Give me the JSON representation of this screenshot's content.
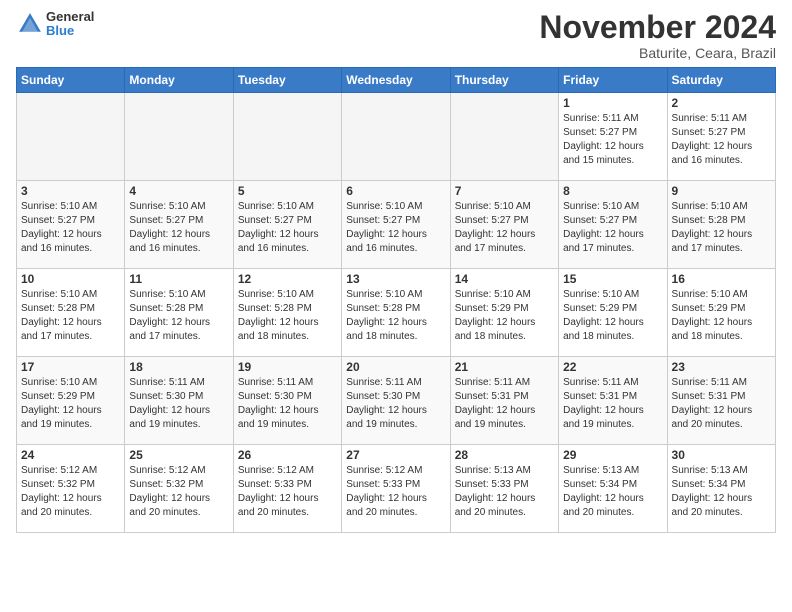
{
  "logo": {
    "general": "General",
    "blue": "Blue"
  },
  "header": {
    "month": "November 2024",
    "location": "Baturite, Ceara, Brazil"
  },
  "weekdays": [
    "Sunday",
    "Monday",
    "Tuesday",
    "Wednesday",
    "Thursday",
    "Friday",
    "Saturday"
  ],
  "weeks": [
    [
      {
        "day": "",
        "info": ""
      },
      {
        "day": "",
        "info": ""
      },
      {
        "day": "",
        "info": ""
      },
      {
        "day": "",
        "info": ""
      },
      {
        "day": "",
        "info": ""
      },
      {
        "day": "1",
        "info": "Sunrise: 5:11 AM\nSunset: 5:27 PM\nDaylight: 12 hours\nand 15 minutes."
      },
      {
        "day": "2",
        "info": "Sunrise: 5:11 AM\nSunset: 5:27 PM\nDaylight: 12 hours\nand 16 minutes."
      }
    ],
    [
      {
        "day": "3",
        "info": "Sunrise: 5:10 AM\nSunset: 5:27 PM\nDaylight: 12 hours\nand 16 minutes."
      },
      {
        "day": "4",
        "info": "Sunrise: 5:10 AM\nSunset: 5:27 PM\nDaylight: 12 hours\nand 16 minutes."
      },
      {
        "day": "5",
        "info": "Sunrise: 5:10 AM\nSunset: 5:27 PM\nDaylight: 12 hours\nand 16 minutes."
      },
      {
        "day": "6",
        "info": "Sunrise: 5:10 AM\nSunset: 5:27 PM\nDaylight: 12 hours\nand 16 minutes."
      },
      {
        "day": "7",
        "info": "Sunrise: 5:10 AM\nSunset: 5:27 PM\nDaylight: 12 hours\nand 17 minutes."
      },
      {
        "day": "8",
        "info": "Sunrise: 5:10 AM\nSunset: 5:27 PM\nDaylight: 12 hours\nand 17 minutes."
      },
      {
        "day": "9",
        "info": "Sunrise: 5:10 AM\nSunset: 5:28 PM\nDaylight: 12 hours\nand 17 minutes."
      }
    ],
    [
      {
        "day": "10",
        "info": "Sunrise: 5:10 AM\nSunset: 5:28 PM\nDaylight: 12 hours\nand 17 minutes."
      },
      {
        "day": "11",
        "info": "Sunrise: 5:10 AM\nSunset: 5:28 PM\nDaylight: 12 hours\nand 17 minutes."
      },
      {
        "day": "12",
        "info": "Sunrise: 5:10 AM\nSunset: 5:28 PM\nDaylight: 12 hours\nand 18 minutes."
      },
      {
        "day": "13",
        "info": "Sunrise: 5:10 AM\nSunset: 5:28 PM\nDaylight: 12 hours\nand 18 minutes."
      },
      {
        "day": "14",
        "info": "Sunrise: 5:10 AM\nSunset: 5:29 PM\nDaylight: 12 hours\nand 18 minutes."
      },
      {
        "day": "15",
        "info": "Sunrise: 5:10 AM\nSunset: 5:29 PM\nDaylight: 12 hours\nand 18 minutes."
      },
      {
        "day": "16",
        "info": "Sunrise: 5:10 AM\nSunset: 5:29 PM\nDaylight: 12 hours\nand 18 minutes."
      }
    ],
    [
      {
        "day": "17",
        "info": "Sunrise: 5:10 AM\nSunset: 5:29 PM\nDaylight: 12 hours\nand 19 minutes."
      },
      {
        "day": "18",
        "info": "Sunrise: 5:11 AM\nSunset: 5:30 PM\nDaylight: 12 hours\nand 19 minutes."
      },
      {
        "day": "19",
        "info": "Sunrise: 5:11 AM\nSunset: 5:30 PM\nDaylight: 12 hours\nand 19 minutes."
      },
      {
        "day": "20",
        "info": "Sunrise: 5:11 AM\nSunset: 5:30 PM\nDaylight: 12 hours\nand 19 minutes."
      },
      {
        "day": "21",
        "info": "Sunrise: 5:11 AM\nSunset: 5:31 PM\nDaylight: 12 hours\nand 19 minutes."
      },
      {
        "day": "22",
        "info": "Sunrise: 5:11 AM\nSunset: 5:31 PM\nDaylight: 12 hours\nand 19 minutes."
      },
      {
        "day": "23",
        "info": "Sunrise: 5:11 AM\nSunset: 5:31 PM\nDaylight: 12 hours\nand 20 minutes."
      }
    ],
    [
      {
        "day": "24",
        "info": "Sunrise: 5:12 AM\nSunset: 5:32 PM\nDaylight: 12 hours\nand 20 minutes."
      },
      {
        "day": "25",
        "info": "Sunrise: 5:12 AM\nSunset: 5:32 PM\nDaylight: 12 hours\nand 20 minutes."
      },
      {
        "day": "26",
        "info": "Sunrise: 5:12 AM\nSunset: 5:33 PM\nDaylight: 12 hours\nand 20 minutes."
      },
      {
        "day": "27",
        "info": "Sunrise: 5:12 AM\nSunset: 5:33 PM\nDaylight: 12 hours\nand 20 minutes."
      },
      {
        "day": "28",
        "info": "Sunrise: 5:13 AM\nSunset: 5:33 PM\nDaylight: 12 hours\nand 20 minutes."
      },
      {
        "day": "29",
        "info": "Sunrise: 5:13 AM\nSunset: 5:34 PM\nDaylight: 12 hours\nand 20 minutes."
      },
      {
        "day": "30",
        "info": "Sunrise: 5:13 AM\nSunset: 5:34 PM\nDaylight: 12 hours\nand 20 minutes."
      }
    ]
  ]
}
